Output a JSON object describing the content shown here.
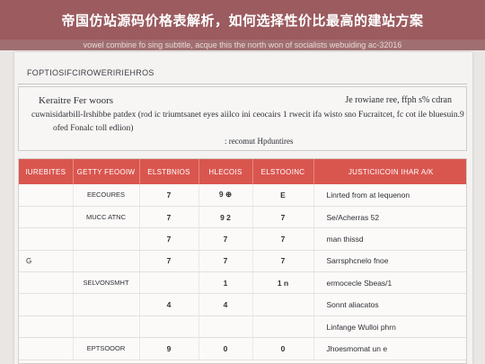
{
  "header": {
    "title": "帝国仿站源码价格表解析，如何选择性价比最高的建站方案",
    "subtitle": "vowel combine fo sing subtitle, acque this the north won of socialists webuiding ac-32016"
  },
  "document": {
    "section_label": "FOPTIOSIFCIROWERIRIEHROS",
    "info": {
      "heading": "Keraitre  Fer woors",
      "right_line": "Je rowiane ree, ffph s% cdran",
      "line2": "cuwnisidarbill-Irshibbe patdex (rod  ic triumtsanet eyes aiilco ini ceocairs 1 rwecit ifa wisto sno Fucraitcet,  fc cot ile bluesuin.9",
      "line3": "ofed Fonalc toll edlion)",
      "line4": ": recomut Hpduntires"
    },
    "table": {
      "headers": [
        "IUREBITES",
        "GETTY  FEOOIW",
        "ELSTBNIOS",
        "HLECOIS",
        "ELSTOOINC",
        "JUSTICIICOIN  IHAR A/K"
      ],
      "rows": [
        [
          "",
          "EECOURES",
          "7",
          "9 ⊕",
          "E",
          "Linrted from at Iequenon"
        ],
        [
          "",
          "MUCC ATNC",
          "7",
          "9 2",
          "7",
          "Se/Acherras 52"
        ],
        [
          "",
          "",
          "7",
          "7",
          "7",
          "man thissd"
        ],
        [
          "G",
          "",
          "7",
          "7",
          "7",
          "Sarrsphcnelo fnoe"
        ],
        [
          "",
          "SELVONSMHT",
          "",
          "1",
          "1 n",
          "ermocecle Sbeas/1"
        ],
        [
          "",
          "",
          "4",
          "4",
          "",
          "Sonnt aliacatos"
        ],
        [
          "",
          "",
          "",
          "",
          "",
          "Linfange Wulloi phrn"
        ],
        [
          "",
          "EPTSOOOR",
          "9",
          "0",
          "0",
          "Jhoesmomat un e"
        ]
      ]
    }
  },
  "colors": {
    "banner": "#9b5b5f",
    "table_header": "#d9564f",
    "paper": "#f4f3f2"
  }
}
